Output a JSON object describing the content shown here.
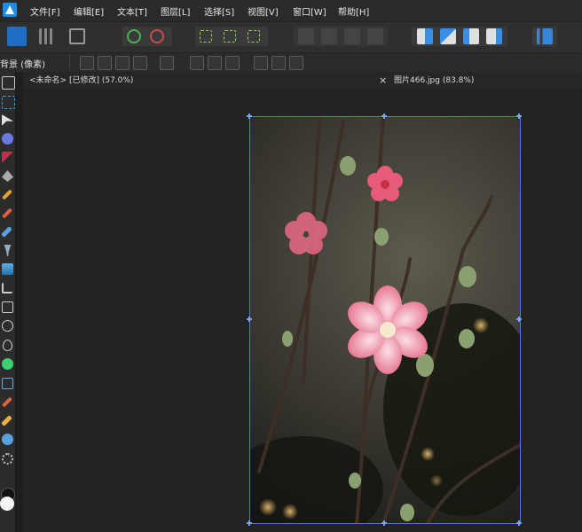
{
  "menu": [
    "文件[F]",
    "编辑[E]",
    "文本[T]",
    "图层[L]",
    "选择[S]",
    "视图[V]",
    "窗口[W]",
    "帮助[H]"
  ],
  "context": {
    "label": "背景 (像素)"
  },
  "tabs": [
    {
      "label": "<未命名> [已修改] (57.0%)"
    },
    {
      "close": "×",
      "label": "图片466.jpg (83.8%)"
    }
  ],
  "colors": {
    "accent": "#1c8ee8",
    "selection": "#4a7fcf"
  }
}
